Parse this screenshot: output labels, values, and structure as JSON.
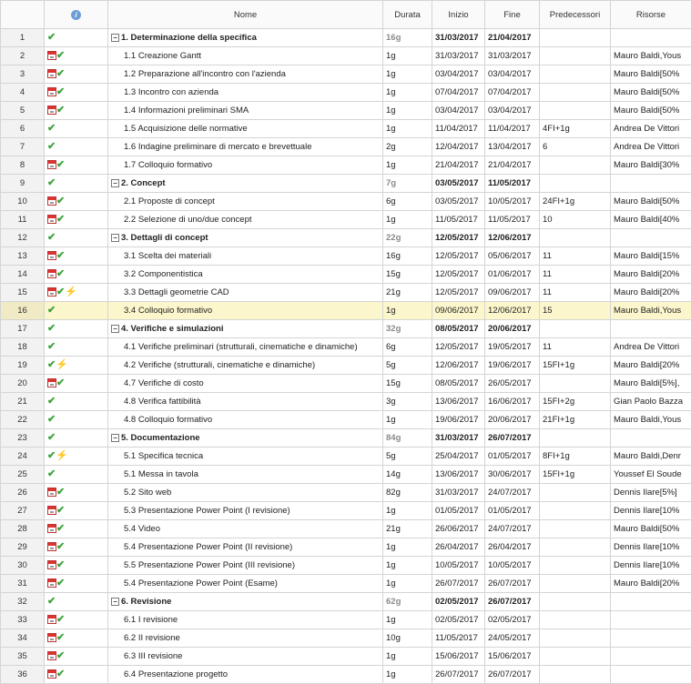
{
  "header": {
    "info_icon_label": "i",
    "nome": "Nome",
    "durata": "Durata",
    "inizio": "Inizio",
    "fine": "Fine",
    "predecessori": "Predecessori",
    "risorse": "Risorse"
  },
  "colors": {
    "check": "#3aa43a",
    "calendar": "#d33",
    "bolt": "#f0b800",
    "selected_row": "#fcf6cc"
  },
  "rows": [
    {
      "id": "1",
      "icons": [
        "check-icon"
      ],
      "summary": true,
      "name": "1. Determinazione della specifica",
      "durata": "16g",
      "inizio": "31/03/2017",
      "fine": "21/04/2017",
      "pred": "",
      "risorse": ""
    },
    {
      "id": "2",
      "icons": [
        "calendar-icon",
        "check-icon"
      ],
      "name": "1.1 Creazione Gantt",
      "durata": "1g",
      "inizio": "31/03/2017",
      "fine": "31/03/2017",
      "pred": "",
      "risorse": "Mauro Baldi,Yous"
    },
    {
      "id": "3",
      "icons": [
        "calendar-icon",
        "check-icon"
      ],
      "name": "1.2 Preparazione all'incontro con l'azienda",
      "durata": "1g",
      "inizio": "03/04/2017",
      "fine": "03/04/2017",
      "pred": "",
      "risorse": "Mauro Baldi[50%"
    },
    {
      "id": "4",
      "icons": [
        "calendar-icon",
        "check-icon"
      ],
      "name": "1.3 Incontro con azienda",
      "durata": "1g",
      "inizio": "07/04/2017",
      "fine": "07/04/2017",
      "pred": "",
      "risorse": "Mauro Baldi[50%"
    },
    {
      "id": "5",
      "icons": [
        "calendar-icon",
        "check-icon"
      ],
      "name": "1.4 Informazioni preliminari SMA",
      "durata": "1g",
      "inizio": "03/04/2017",
      "fine": "03/04/2017",
      "pred": "",
      "risorse": "Mauro Baldi[50%"
    },
    {
      "id": "6",
      "icons": [
        "check-icon"
      ],
      "name": "1.5 Acquisizione delle normative",
      "durata": "1g",
      "inizio": "11/04/2017",
      "fine": "11/04/2017",
      "pred": "4FI+1g",
      "risorse": "Andrea De Vittori"
    },
    {
      "id": "7",
      "icons": [
        "check-icon"
      ],
      "name": "1.6 Indagine preliminare di mercato e brevettuale",
      "durata": "2g",
      "inizio": "12/04/2017",
      "fine": "13/04/2017",
      "pred": "6",
      "risorse": "Andrea De Vittori"
    },
    {
      "id": "8",
      "icons": [
        "calendar-icon",
        "check-icon"
      ],
      "name": "1.7 Colloquio formativo",
      "durata": "1g",
      "inizio": "21/04/2017",
      "fine": "21/04/2017",
      "pred": "",
      "risorse": "Mauro Baldi[30%"
    },
    {
      "id": "9",
      "icons": [
        "check-icon"
      ],
      "summary": true,
      "name": "2. Concept",
      "durata": "7g",
      "inizio": "03/05/2017",
      "fine": "11/05/2017",
      "pred": "",
      "risorse": ""
    },
    {
      "id": "10",
      "icons": [
        "calendar-icon",
        "check-icon"
      ],
      "name": "2.1 Proposte di concept",
      "durata": "6g",
      "inizio": "03/05/2017",
      "fine": "10/05/2017",
      "pred": "24FI+1g",
      "risorse": "Mauro Baldi[50%"
    },
    {
      "id": "11",
      "icons": [
        "calendar-icon",
        "check-icon"
      ],
      "name": "2.2 Selezione di uno/due concept",
      "durata": "1g",
      "inizio": "11/05/2017",
      "fine": "11/05/2017",
      "pred": "10",
      "risorse": "Mauro Baldi[40%"
    },
    {
      "id": "12",
      "icons": [
        "check-icon"
      ],
      "summary": true,
      "name": "3. Dettagli di concept",
      "durata": "22g",
      "inizio": "12/05/2017",
      "fine": "12/06/2017",
      "pred": "",
      "risorse": ""
    },
    {
      "id": "13",
      "icons": [
        "calendar-icon",
        "check-icon"
      ],
      "name": "3.1 Scelta dei materiali",
      "durata": "16g",
      "inizio": "12/05/2017",
      "fine": "05/06/2017",
      "pred": "11",
      "risorse": "Mauro Baldi[15%"
    },
    {
      "id": "14",
      "icons": [
        "calendar-icon",
        "check-icon"
      ],
      "name": "3.2 Componentistica",
      "durata": "15g",
      "inizio": "12/05/2017",
      "fine": "01/06/2017",
      "pred": "11",
      "risorse": "Mauro Baldi[20%"
    },
    {
      "id": "15",
      "icons": [
        "calendar-icon",
        "check-icon",
        "bolt-icon"
      ],
      "name": "3.3 Dettagli geometrie CAD",
      "durata": "21g",
      "inizio": "12/05/2017",
      "fine": "09/06/2017",
      "pred": "11",
      "risorse": "Mauro Baldi[20%"
    },
    {
      "id": "16",
      "icons": [
        "check-icon"
      ],
      "selected": true,
      "name": "3.4 Colloquio formativo",
      "durata": "1g",
      "inizio": "09/06/2017",
      "fine": "12/06/2017",
      "pred": "15",
      "risorse": "Mauro Baldi,Yous"
    },
    {
      "id": "17",
      "icons": [
        "check-icon"
      ],
      "summary": true,
      "name": "4. Verifiche e simulazioni",
      "durata": "32g",
      "inizio": "08/05/2017",
      "fine": "20/06/2017",
      "pred": "",
      "risorse": ""
    },
    {
      "id": "18",
      "icons": [
        "check-icon"
      ],
      "name": "4.1 Verifiche preliminari (strutturali, cinematiche e dinamiche)",
      "durata": "6g",
      "inizio": "12/05/2017",
      "fine": "19/05/2017",
      "pred": "11",
      "risorse": "Andrea De Vittori"
    },
    {
      "id": "19",
      "icons": [
        "check-icon",
        "bolt-icon"
      ],
      "name": "4.2 Verifiche (strutturali, cinematiche e dinamiche)",
      "durata": "5g",
      "inizio": "12/06/2017",
      "fine": "19/06/2017",
      "pred": "15FI+1g",
      "risorse": "Mauro Baldi[20%"
    },
    {
      "id": "20",
      "icons": [
        "calendar-icon",
        "check-icon"
      ],
      "name": "4.7 Verifiche di costo",
      "durata": "15g",
      "inizio": "08/05/2017",
      "fine": "26/05/2017",
      "pred": "",
      "risorse": "Mauro Baldi[5%],"
    },
    {
      "id": "21",
      "icons": [
        "check-icon"
      ],
      "name": "4.8 Verifica fattibilità",
      "durata": "3g",
      "inizio": "13/06/2017",
      "fine": "16/06/2017",
      "pred": "15FI+2g",
      "risorse": "Gian Paolo Bazza"
    },
    {
      "id": "22",
      "icons": [
        "check-icon"
      ],
      "name": "4.8 Colloquio formativo",
      "durata": "1g",
      "inizio": "19/06/2017",
      "fine": "20/06/2017",
      "pred": "21FI+1g",
      "risorse": "Mauro Baldi,Yous"
    },
    {
      "id": "23",
      "icons": [
        "check-icon"
      ],
      "summary": true,
      "name": "5. Documentazione",
      "durata": "84g",
      "inizio": "31/03/2017",
      "fine": "26/07/2017",
      "pred": "",
      "risorse": ""
    },
    {
      "id": "24",
      "icons": [
        "check-icon",
        "bolt-icon"
      ],
      "name": "5.1 Specifica tecnica",
      "durata": "5g",
      "inizio": "25/04/2017",
      "fine": "01/05/2017",
      "pred": "8FI+1g",
      "risorse": "Mauro Baldi,Denr"
    },
    {
      "id": "25",
      "icons": [
        "check-icon"
      ],
      "name": "5.1 Messa in tavola",
      "durata": "14g",
      "inizio": "13/06/2017",
      "fine": "30/06/2017",
      "pred": "15FI+1g",
      "risorse": "Youssef El Soude"
    },
    {
      "id": "26",
      "icons": [
        "calendar-icon",
        "check-icon"
      ],
      "name": "5.2 Sito web",
      "durata": "82g",
      "inizio": "31/03/2017",
      "fine": "24/07/2017",
      "pred": "",
      "risorse": "Dennis Ilare[5%]"
    },
    {
      "id": "27",
      "icons": [
        "calendar-icon",
        "check-icon"
      ],
      "name": "5.3  Presentazione Power Point (I revisione)",
      "durata": "1g",
      "inizio": "01/05/2017",
      "fine": "01/05/2017",
      "pred": "",
      "risorse": "Dennis Ilare[10%"
    },
    {
      "id": "28",
      "icons": [
        "calendar-icon",
        "check-icon"
      ],
      "name": "5.4 Video",
      "durata": "21g",
      "inizio": "26/06/2017",
      "fine": "24/07/2017",
      "pred": "",
      "risorse": "Mauro Baldi[50%"
    },
    {
      "id": "29",
      "icons": [
        "calendar-icon",
        "check-icon"
      ],
      "name": "5.4 Presentazione Power Point (II revisione)",
      "durata": "1g",
      "inizio": "26/04/2017",
      "fine": "26/04/2017",
      "pred": "",
      "risorse": "Dennis Ilare[10%"
    },
    {
      "id": "30",
      "icons": [
        "calendar-icon",
        "check-icon"
      ],
      "name": "5.5 Presentazione Power Point (III revisione)",
      "durata": "1g",
      "inizio": "10/05/2017",
      "fine": "10/05/2017",
      "pred": "",
      "risorse": "Dennis Ilare[10%"
    },
    {
      "id": "31",
      "icons": [
        "calendar-icon",
        "check-icon"
      ],
      "name": "5.4 Presentazione Power Point (Esame)",
      "durata": "1g",
      "inizio": "26/07/2017",
      "fine": "26/07/2017",
      "pred": "",
      "risorse": "Mauro Baldi[20%"
    },
    {
      "id": "32",
      "icons": [
        "check-icon"
      ],
      "summary": true,
      "name": "6. Revisione",
      "durata": "62g",
      "inizio": "02/05/2017",
      "fine": "26/07/2017",
      "pred": "",
      "risorse": ""
    },
    {
      "id": "33",
      "icons": [
        "calendar-icon",
        "check-icon"
      ],
      "name": "6.1 I revisione",
      "durata": "1g",
      "inizio": "02/05/2017",
      "fine": "02/05/2017",
      "pred": "",
      "risorse": ""
    },
    {
      "id": "34",
      "icons": [
        "calendar-icon",
        "check-icon"
      ],
      "name": "6.2 II revisione",
      "durata": "10g",
      "inizio": "11/05/2017",
      "fine": "24/05/2017",
      "pred": "",
      "risorse": ""
    },
    {
      "id": "35",
      "icons": [
        "calendar-icon",
        "check-icon"
      ],
      "name": "6.3 III revisione",
      "durata": "1g",
      "inizio": "15/06/2017",
      "fine": "15/06/2017",
      "pred": "",
      "risorse": ""
    },
    {
      "id": "36",
      "icons": [
        "calendar-icon",
        "check-icon"
      ],
      "name": "6.4 Presentazione progetto",
      "durata": "1g",
      "inizio": "26/07/2017",
      "fine": "26/07/2017",
      "pred": "",
      "risorse": ""
    }
  ]
}
